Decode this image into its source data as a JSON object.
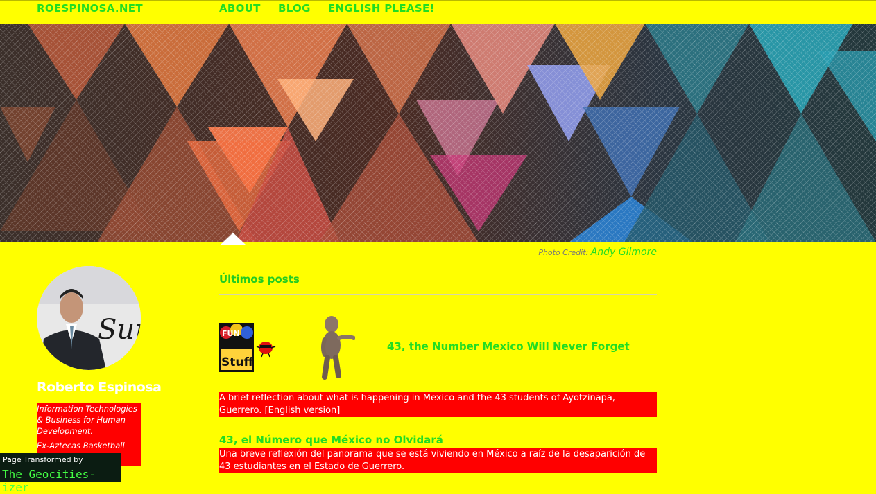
{
  "nav": {
    "site": "ROESPINOSA.NET",
    "about": "ABOUT",
    "blog": "BLOG",
    "english": "ENGLISH PLEASE!"
  },
  "hero": {
    "credit_prefix": "Photo Credit:",
    "credit_name": "Andy Gilmore"
  },
  "section": {
    "title": "Últimos posts"
  },
  "posts": [
    {
      "title": "43, the Number Mexico Will Never Forget",
      "excerpt": "A brief reflection about what is happening in Mexico and the 43 students of Ayotzinapa, Guerrero. [English version]"
    },
    {
      "title": "43, el Número que México no Olvidará",
      "excerpt": "Una breve reflexión del panorama que se está viviendo en México a raíz de la desaparición de 43 estudiantes en el Estado de Guerrero."
    }
  ],
  "gifs": {
    "fun": "FUN",
    "stuff": "Stuff"
  },
  "author": {
    "name": "Roberto Espinosa",
    "bio_line1": "Information Technologies & Business for Human Development.",
    "bio_line2": "Ex-Aztecas Basketball"
  },
  "badge": {
    "line1": "Page Transformed by",
    "line2": "The Geocities-izer"
  },
  "colors": {
    "background": "#ffff00",
    "link": "#22dd22",
    "highlight": "#ff0000"
  }
}
